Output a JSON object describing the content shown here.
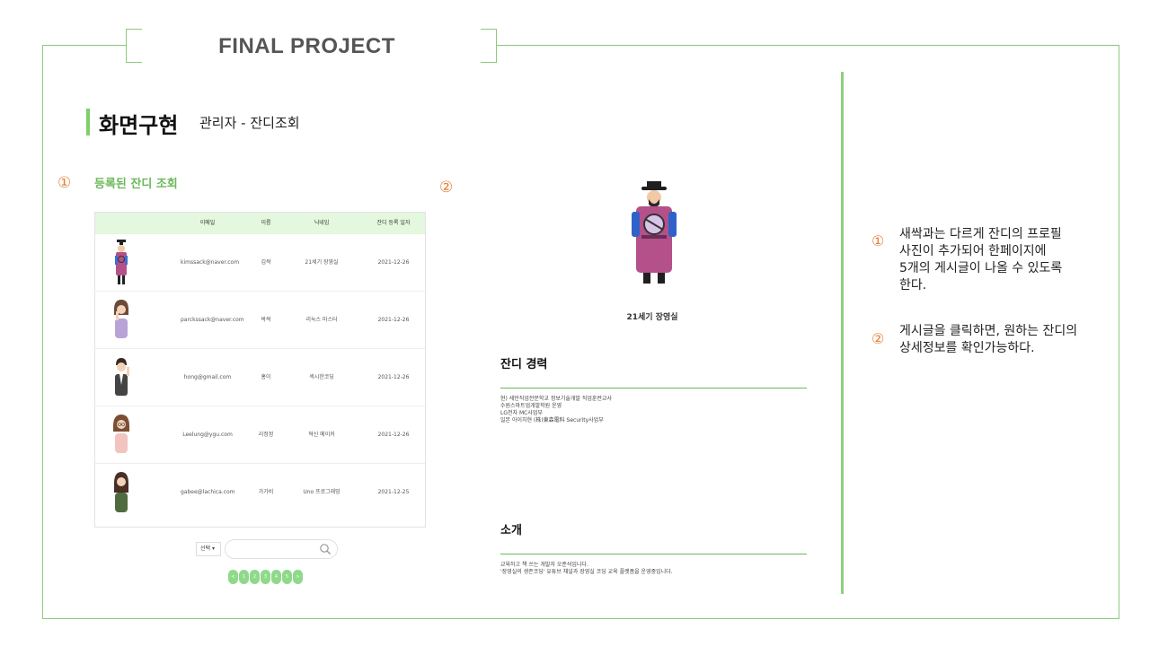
{
  "slide": {
    "title": "FINAL PROJECT",
    "section_title": "화면구현",
    "section_sub": "관리자 - 잔디조회",
    "colors": {
      "accent_green": "#8cc97a",
      "number_orange": "#e7803a"
    }
  },
  "left_panel": {
    "num": "①",
    "list_title": "등록된 잔디 조회",
    "table": {
      "headers": [
        "이메일",
        "이름",
        "닉네임",
        "잔디 등록 일자"
      ],
      "rows": [
        {
          "avatar": "joseon-man-avatar",
          "email": "kimssack@naver.com",
          "name": "김싹",
          "nickname": "21세기 장영실",
          "date": "2021-12-26"
        },
        {
          "avatar": "woman-thinking-avatar",
          "email": "parckssack@naver.com",
          "name": "박싹",
          "nickname": "리눅스 마스터",
          "date": "2021-12-26"
        },
        {
          "avatar": "man-suit-avatar",
          "email": "hong@gmail.com",
          "name": "홍이",
          "nickname": "섹시한코딩",
          "date": "2021-12-26"
        },
        {
          "avatar": "woman-glasses-avatar",
          "email": "Leelung@ygu.com",
          "name": "리정정",
          "nickname": "혁신 메이커",
          "date": "2021-12-26"
        },
        {
          "avatar": "woman-green-avatar",
          "email": "gabee@lachica.com",
          "name": "가가비",
          "nickname": "Uno 프로그래밍",
          "date": "2021-12-25"
        }
      ]
    },
    "search": {
      "select_value": "선택",
      "placeholder": ""
    },
    "pagination": [
      "<",
      "1",
      "2",
      "3",
      "4",
      "5",
      ">"
    ]
  },
  "detail_panel": {
    "num": "②",
    "nickname": "21세기 장영실",
    "career_title": "잔디 경력",
    "career_text": "현) 세민직업전문학교 정보기술개발 직업훈련교사\n수원스마트업개발학원 운영\nLG전자 MC사업부\n일본 아이치현 (株)東森電料 Security사업부",
    "intro_title": "소개",
    "intro_text": "교육하고 책 쓰는 개발자 오준석입니다.\n'장영실의 생존코딩' 유튜브 채널과 장영실 코딩 교육 플랫폼을 운영중입니다."
  },
  "notes": [
    {
      "num": "①",
      "text": "새싹과는 다르게 잔디의 프로필\n사진이 추가되어 한페이지에\n5개의 게시글이 나올 수 있도록\n한다."
    },
    {
      "num": "②",
      "text": "게시글을 클릭하면, 원하는 잔디의\n상세정보를 확인가능하다."
    }
  ]
}
